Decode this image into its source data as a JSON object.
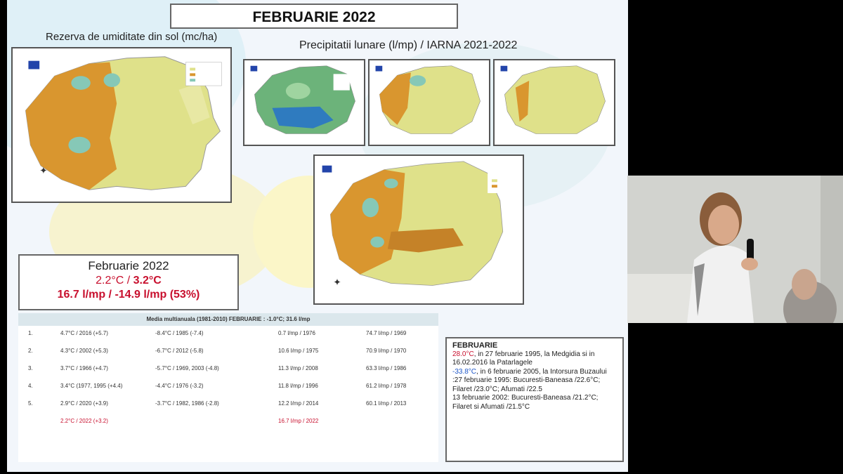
{
  "slide": {
    "title": "FEBRUARIE 2022",
    "soil_caption": "Rezerva de umiditate din sol (mc/ha)",
    "precip_caption": "Precipitatii lunare (l/mp) / IARNA 2021-2022"
  },
  "summary": {
    "month": "Februarie 2022",
    "temp_prefix": "2.2°C / ",
    "temp_bold": "3.2°C",
    "precip": "16.7 l/mp /  -14.9 l/mp (53%)"
  },
  "table": {
    "header": "Media multianuala (1981-2010)  FEBRUARIE : -1.0°C; 31.6 l/mp",
    "rows": [
      {
        "n": "1.",
        "a": "4.7°C / 2016 (+5.7)",
        "b": "-8.4°C / 1985 (-7.4)",
        "c": "0.7 l/mp / 1976",
        "d": "74.7 l/mp / 1969"
      },
      {
        "n": "2.",
        "a": "4.3°C / 2002 (+5.3)",
        "b": "-6.7°C / 2012 (-5.8)",
        "c": "10.6 l/mp / 1975",
        "d": "70.9 l/mp / 1970"
      },
      {
        "n": "3.",
        "a": "3.7°C / 1966 (+4.7)",
        "b": "-5.7°C / 1969, 2003 (-4.8)",
        "c": "11.3 l/mp / 2008",
        "d": "63.3 l/mp / 1986"
      },
      {
        "n": "4.",
        "a": "3.4°C (1977, 1995 (+4.4)",
        "b": "-4.4°C / 1976 (-3.2)",
        "c": "11.8 l/mp / 1996",
        "d": "61.2 l/mp / 1978"
      },
      {
        "n": "5.",
        "a": "2.9°C / 2020 (+3.9)",
        "b": "-3.7°C / 1982, 1986 (-2.8)",
        "c": "12.2 l/mp / 2014",
        "d": "60.1 l/mp / 2013"
      },
      {
        "n": "",
        "a": "2.2°C / 2022 (+3.2)",
        "b": "",
        "c": "16.7 l/mp / 2022",
        "d": ""
      }
    ]
  },
  "records": {
    "heading": "FEBRUARIE",
    "hot_value": "28.0°C",
    "hot_text": ", in 27 februarie 1995, la Medgidia si in 16.02.2016 la Patarlagele",
    "cold_value": "-33.8°C",
    "cold_text": ", in 6 februarie 2005, la Intorsura Buzaului",
    "line3": ":27 februarie 1995: Bucuresti-Baneasa /22.6°C; Filaret /23.0°C; Afumati /22.5",
    "line4": "13 februarie 2002: Bucuresti-Baneasa /21.2°C; Filaret si Afumati /21.5°C"
  },
  "colors": {
    "accent_red": "#c8102e",
    "accent_blue": "#1b55c8",
    "map_orange": "#d9962f",
    "map_yellow": "#dfe18a",
    "map_green": "#6cb37a"
  }
}
